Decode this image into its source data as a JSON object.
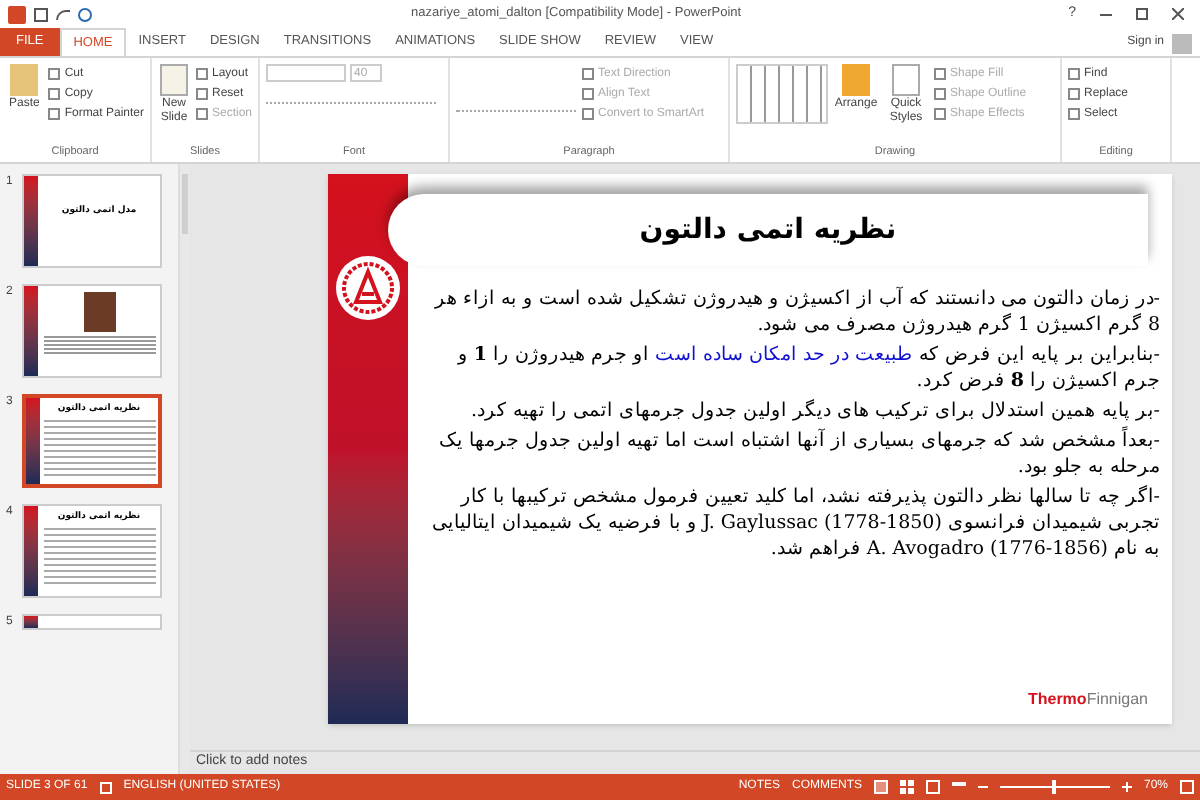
{
  "window": {
    "title": "nazariye_atomi_dalton [Compatibility Mode] - PowerPoint",
    "help": "?",
    "sign_in": "Sign in"
  },
  "tabs": [
    {
      "label": "FILE",
      "kind": "file",
      "selected": false
    },
    {
      "label": "HOME",
      "kind": "tab",
      "selected": true
    },
    {
      "label": "INSERT",
      "kind": "tab",
      "selected": false
    },
    {
      "label": "DESIGN",
      "kind": "tab",
      "selected": false
    },
    {
      "label": "TRANSITIONS",
      "kind": "tab",
      "selected": false
    },
    {
      "label": "ANIMATIONS",
      "kind": "tab",
      "selected": false
    },
    {
      "label": "SLIDE SHOW",
      "kind": "tab",
      "selected": false
    },
    {
      "label": "REVIEW",
      "kind": "tab",
      "selected": false
    },
    {
      "label": "VIEW",
      "kind": "tab",
      "selected": false
    }
  ],
  "ribbon": {
    "clipboard": {
      "paste": "Paste",
      "cut": "Cut",
      "copy": "Copy",
      "format_painter": "Format Painter",
      "label": "Clipboard"
    },
    "slides": {
      "new_slide": "New Slide",
      "layout": "Layout",
      "reset": "Reset",
      "section": "Section",
      "label": "Slides"
    },
    "font": {
      "size": "40",
      "label": "Font"
    },
    "paragraph": {
      "text_direction": "Text Direction",
      "align_text": "Align Text",
      "convert": "Convert to SmartArt",
      "label": "Paragraph"
    },
    "drawing": {
      "arrange": "Arrange",
      "quick_styles": "Quick Styles",
      "shape_fill": "Shape Fill",
      "shape_outline": "Shape Outline",
      "shape_effects": "Shape Effects",
      "label": "Drawing"
    },
    "editing": {
      "find": "Find",
      "replace": "Replace",
      "select": "Select",
      "label": "Editing"
    }
  },
  "thumbnails": [
    {
      "number": "1",
      "kind": "title",
      "title": "مدل اتمی دالتون",
      "selected": false
    },
    {
      "number": "2",
      "kind": "photo",
      "selected": false
    },
    {
      "number": "3",
      "kind": "text",
      "title": "نظریه اتمی دالتون",
      "selected": true
    },
    {
      "number": "4",
      "kind": "bullets",
      "title": "نظریه اتمی دالتون",
      "selected": false
    },
    {
      "number": "5",
      "kind": "partial",
      "selected": false
    }
  ],
  "slide": {
    "title": "نظریه اتمی دالتون",
    "paragraphs": [
      [
        {
          "text": "-در زمان دالتون می دانستند که آب از اکسیژن و هیدروژن تشکیل شده است و به ازاء هر 8 گرم اکسیژن 1 گرم هیدروژن مصرف می شود.",
          "highlighted": false
        }
      ],
      [
        {
          "text": "-بنابراین بر پایه این فرض که ",
          "highlighted": false
        },
        {
          "text": "طبیعت در حد امکان ساده است",
          "highlighted": true
        },
        {
          "text": " او جرم هیدروژن را **1** و جرم اکسیژن را **8** فرض کرد.",
          "highlighted": false
        }
      ],
      [
        {
          "text": "-بر پایه همین استدلال برای ترکیب های دیگر اولین جدول جرمهای اتمی را تهیه کرد.",
          "highlighted": false
        }
      ],
      [
        {
          "text": "-بعداً مشخص شد که جرمهای بسیاری از آنها اشتباه است اما تهیه اولین جدول جرمها یک مرحله به جلو بود.",
          "highlighted": false
        }
      ],
      [
        {
          "text": "-اگر چه تا سالها نظر دالتون پذیرفته نشد، اما کلید تعیین فرمول مشخص ترکیبها با کار تجربی شیمیدان فرانسوی J. Gaylussac (1778-1850) و با فرضیه یک شیمیدان ایتالیایی به نام A. Avogadro (1776-1856) فراهم شد.",
          "highlighted": false
        }
      ]
    ],
    "logo": {
      "brand": "Thermo",
      "product": "Finnigan"
    }
  },
  "notes": {
    "placeholder": "Click to add notes"
  },
  "status_bar": {
    "slide": "SLIDE 3 OF 61",
    "language": "ENGLISH (UNITED STATES)",
    "notes": "NOTES",
    "comments": "COMMENTS",
    "zoom": "70%",
    "zoom_slider": {
      "level": 0.5
    }
  }
}
